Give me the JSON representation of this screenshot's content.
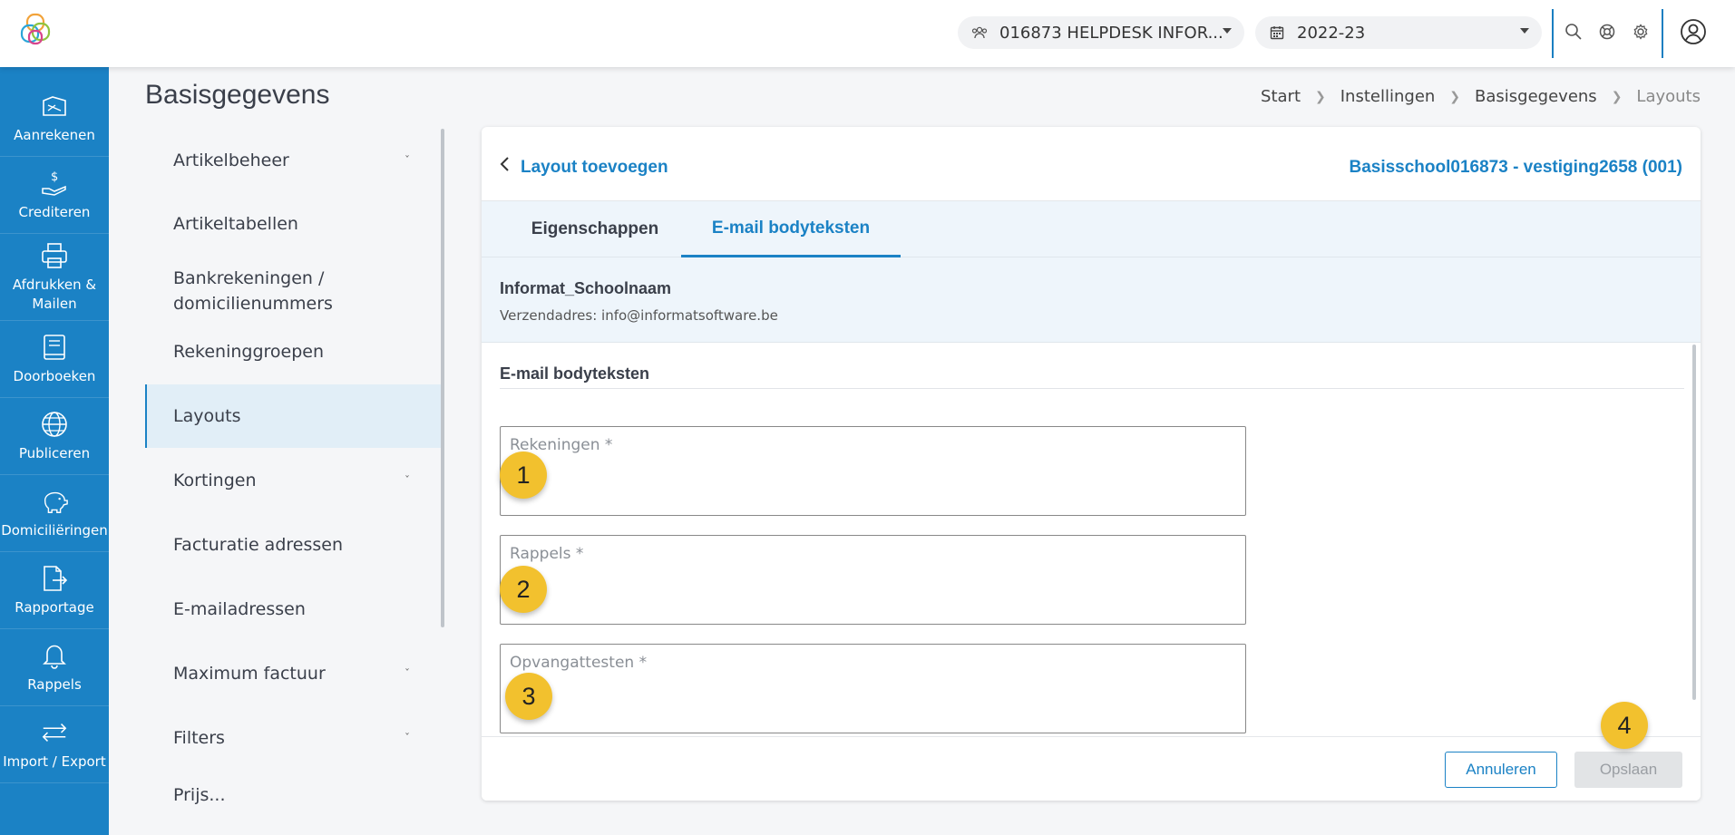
{
  "topbar": {
    "organisation": "016873 HELPDESK INFOR...",
    "school_year": "2022-23",
    "icons": [
      "search-icon",
      "help-icon",
      "gear-icon",
      "user-icon"
    ]
  },
  "sidebar": {
    "items": [
      {
        "label": "Aanrekenen",
        "icon": "invoice-icon"
      },
      {
        "label": "Crediteren",
        "icon": "credit-hand-icon"
      },
      {
        "label": "Afdrukken & Mailen",
        "icon": "printer-icon"
      },
      {
        "label": "Doorboeken",
        "icon": "book-icon"
      },
      {
        "label": "Publiceren",
        "icon": "globe-icon"
      },
      {
        "label": "Domiciliëringen",
        "icon": "piggy-bank-icon"
      },
      {
        "label": "Rapportage",
        "icon": "report-icon"
      },
      {
        "label": "Rappels",
        "icon": "bell-icon"
      },
      {
        "label": "Import / Export",
        "icon": "transfer-icon"
      }
    ]
  },
  "page": {
    "title": "Basisgegevens",
    "breadcrumb": [
      "Start",
      "Instellingen",
      "Basisgegevens",
      "Layouts"
    ]
  },
  "submenu": {
    "items": [
      {
        "label": "Artikelbeheer",
        "expandable": true
      },
      {
        "label": "Artikeltabellen",
        "expandable": false
      },
      {
        "label": "Bankrekeningen / domicilienummers",
        "expandable": false
      },
      {
        "label": "Rekeninggroepen",
        "expandable": false
      },
      {
        "label": "Layouts",
        "expandable": false,
        "active": true
      },
      {
        "label": "Kortingen",
        "expandable": true
      },
      {
        "label": "Facturatie adressen",
        "expandable": false
      },
      {
        "label": "E-mailadressen",
        "expandable": false
      },
      {
        "label": "Maximum factuur",
        "expandable": true
      },
      {
        "label": "Filters",
        "expandable": true
      },
      {
        "label": "Prijs...",
        "expandable": false
      }
    ]
  },
  "card": {
    "title": "Layout toevoegen",
    "school": "Basisschool016873 - vestiging2658 (001)",
    "tabs": [
      "Eigenschappen",
      "E-mail bodyteksten"
    ],
    "active_tab": "E-mail bodyteksten",
    "info": {
      "name": "Informat_Schoolnaam",
      "sender": "Verzendadres: info@informatsoftware.be"
    },
    "section_title": "E-mail bodyteksten",
    "fields": [
      {
        "label": "Rekeningen *",
        "value": ""
      },
      {
        "label": "Rappels *",
        "value": ""
      },
      {
        "label": "Opvangattesten *",
        "value": ""
      }
    ],
    "buttons": {
      "cancel": "Annuleren",
      "save": "Opslaan"
    }
  },
  "markers": [
    "1",
    "2",
    "3",
    "4"
  ],
  "colors": {
    "brand_blue": "#1b82c5",
    "marker_yellow": "#f2c12e",
    "active_bg": "#e1eef7"
  }
}
